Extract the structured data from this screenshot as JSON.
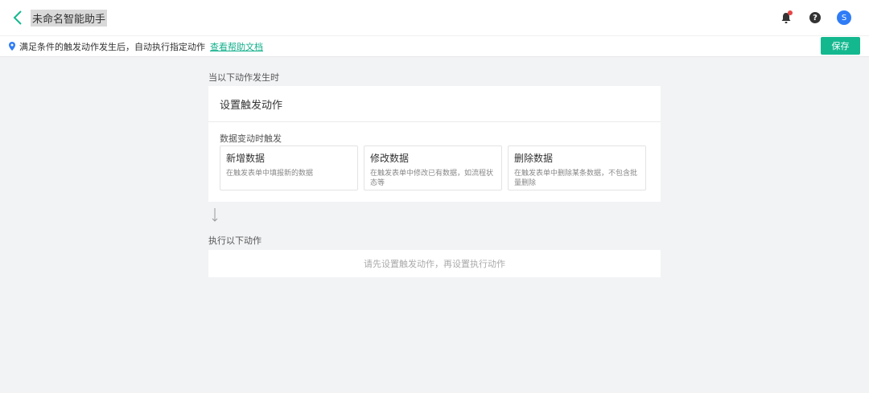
{
  "header": {
    "title": "未命名智能助手",
    "avatar_letter": "S"
  },
  "notice": {
    "text": "满足条件的触发动作发生后，自动执行指定动作",
    "link": "查看帮助文档",
    "save_label": "保存"
  },
  "trigger": {
    "section_label": "当以下动作发生时",
    "card_title": "设置触发动作",
    "group_label": "数据变动时触发",
    "options": [
      {
        "title": "新增数据",
        "desc": "在触发表单中填报新的数据"
      },
      {
        "title": "修改数据",
        "desc": "在触发表单中修改已有数据，如流程状态等"
      },
      {
        "title": "删除数据",
        "desc": "在触发表单中删除某条数据，不包含批量删除"
      }
    ]
  },
  "action": {
    "section_label": "执行以下动作",
    "placeholder": "请先设置触发动作，再设置执行动作"
  },
  "colors": {
    "accent": "#14b88f",
    "link": "#13b08c",
    "avatar": "#2f7cf6",
    "badge": "#e64646"
  }
}
